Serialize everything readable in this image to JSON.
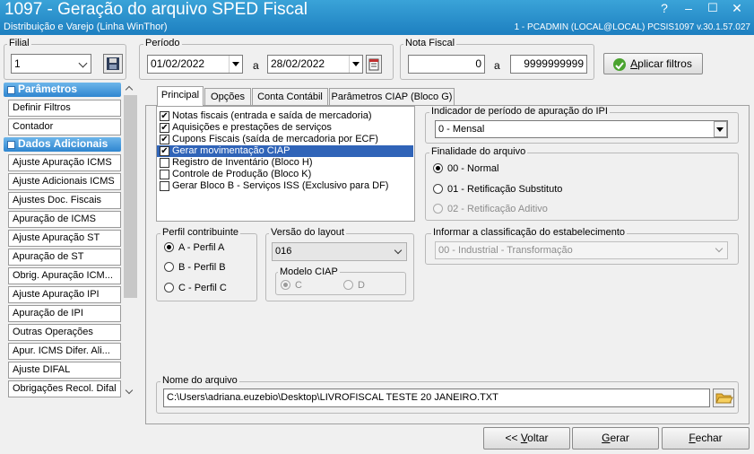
{
  "window": {
    "title": "1097 - Geração do arquivo SPED Fiscal",
    "subtitle": "Distribuição e Varejo (Linha WinThor)",
    "user_info": "1 - PCADMIN (LOCAL@LOCAL)   PCSIS1097  v.30.1.57.027",
    "help": "?",
    "minimize": "–",
    "maximize": "☐",
    "close": "✕"
  },
  "filters": {
    "filial_label": "Filial",
    "filial_value": "1",
    "periodo_label": "Período",
    "date_start": "01/02/2022",
    "date_sep": "a",
    "date_end": "28/02/2022",
    "nota_label": "Nota Fiscal",
    "nota_start": "0",
    "nota_sep": "a",
    "nota_end": "9999999999",
    "apply_prefix": "A",
    "apply_rest": "plicar filtros"
  },
  "sidebar": {
    "sec1": "Parâmetros",
    "items1": [
      "Definir Filtros",
      "Contador"
    ],
    "sec2": "Dados Adicionais",
    "items2": [
      "Ajuste Apuração ICMS",
      "Ajuste Adicionais ICMS",
      "Ajustes Doc. Fiscais",
      "Apuração de ICMS",
      "Ajuste Apuração ST",
      "Apuração de ST",
      "Obrig. Apuração ICM...",
      "Ajuste Apuração IPI",
      "Apuração de IPI",
      "Outras Operações",
      "Apur. ICMS Difer. Ali...",
      "Ajuste DIFAL",
      "Obrigações Recol. Difal"
    ]
  },
  "tabs": [
    "Principal",
    "Opções",
    "Conta Contábil",
    "Parâmetros CIAP (Bloco G)"
  ],
  "checklist": [
    {
      "label": "Notas fiscais (entrada e saída de mercadoria)",
      "checked": true
    },
    {
      "label": "Aquisições e prestações de serviços",
      "checked": true
    },
    {
      "label": "Cupons Fiscais (saída de mercadoria por ECF)",
      "checked": true
    },
    {
      "label": "Gerar movimentação CIAP",
      "checked": true
    },
    {
      "label": "Registro de Inventário (Bloco H)",
      "checked": false
    },
    {
      "label": "Controle de Produção (Bloco K)",
      "checked": false
    },
    {
      "label": "Gerar Bloco B - Serviços ISS (Exclusivo para DF)",
      "checked": false
    }
  ],
  "ipi": {
    "label": "Indicador de período de apuração do IPI",
    "value": "0 - Mensal"
  },
  "finalidade": {
    "label": "Finalidade do arquivo",
    "options": [
      "00 - Normal",
      "01 - Retificação Substituto",
      "02 - Retificação Aditivo"
    ]
  },
  "perfil": {
    "label": "Perfil contribuinte",
    "options": [
      "A - Perfil A",
      "B - Perfil B",
      "C - Perfil C"
    ]
  },
  "versao": {
    "label": "Versão do layout",
    "value": "016"
  },
  "ciap": {
    "label": "Modelo CIAP",
    "options": [
      "C",
      "D"
    ]
  },
  "classificacao": {
    "label": "Informar a classificação do estabelecimento",
    "value": "00 - Industrial - Transformação"
  },
  "arquivo": {
    "label": "Nome do arquivo",
    "value": "C:\\Users\\adriana.euzebio\\Desktop\\LIVROFISCAL TESTE 20 JANEIRO.TXT"
  },
  "footer": {
    "voltar_pre": "<< ",
    "voltar_u": "V",
    "voltar_rest": "oltar",
    "gerar_u": "G",
    "gerar_rest": "erar",
    "fechar_u": "F",
    "fechar_rest": "echar"
  }
}
